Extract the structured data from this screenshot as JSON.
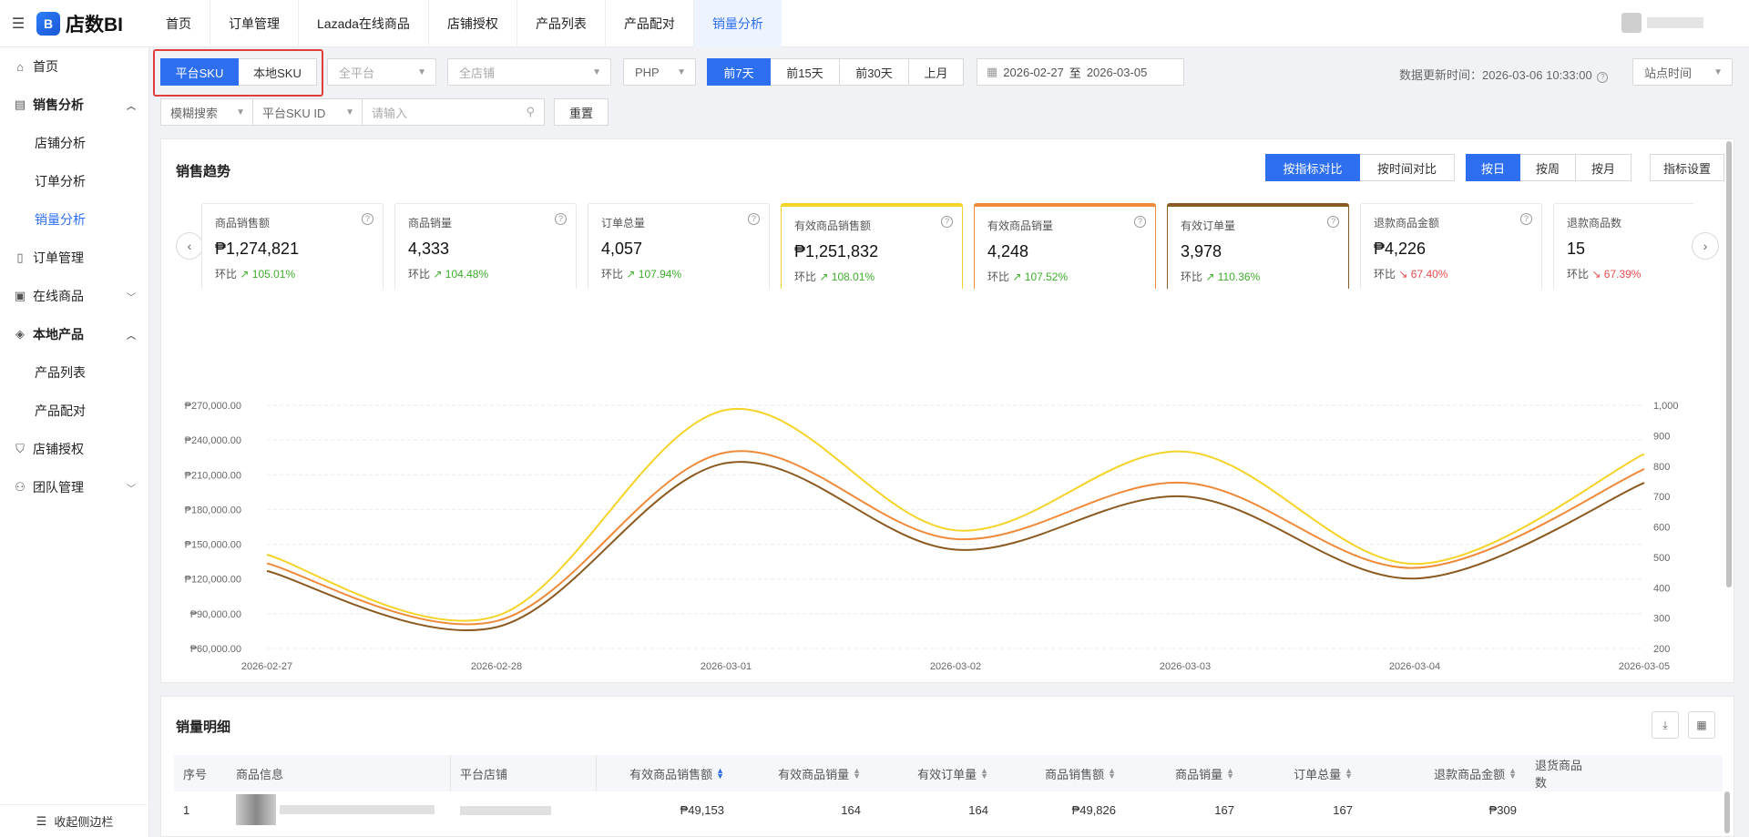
{
  "app": {
    "name": "店数BI",
    "logo_mark": "B"
  },
  "top_tabs": [
    {
      "label": "首页",
      "active": false
    },
    {
      "label": "订单管理",
      "active": false
    },
    {
      "label": "Lazada在线商品",
      "active": false
    },
    {
      "label": "店铺授权",
      "active": false
    },
    {
      "label": "产品列表",
      "active": false
    },
    {
      "label": "产品配对",
      "active": false
    },
    {
      "label": "销量分析",
      "active": true
    }
  ],
  "sidebar": {
    "items": [
      {
        "label": "首页",
        "icon": "home-icon",
        "type": "top"
      },
      {
        "label": "销售分析",
        "icon": "chart-icon",
        "type": "group-open"
      },
      {
        "label": "店铺分析",
        "type": "sub"
      },
      {
        "label": "订单分析",
        "type": "sub"
      },
      {
        "label": "销量分析",
        "type": "sub-active"
      },
      {
        "label": "订单管理",
        "icon": "document-icon",
        "type": "top"
      },
      {
        "label": "在线商品",
        "icon": "shop-icon",
        "type": "group-closed"
      },
      {
        "label": "本地产品",
        "icon": "box-icon",
        "type": "group-open"
      },
      {
        "label": "产品列表",
        "type": "sub"
      },
      {
        "label": "产品配对",
        "type": "sub"
      },
      {
        "label": "店铺授权",
        "icon": "shield-icon",
        "type": "top"
      },
      {
        "label": "团队管理",
        "icon": "team-icon",
        "type": "group-closed"
      }
    ],
    "collapse_label": "收起侧边栏"
  },
  "filters": {
    "sku_platform": "平台SKU",
    "sku_local": "本地SKU",
    "platform_placeholder": "全平台",
    "shop_placeholder": "全店铺",
    "currency": "PHP",
    "period_buttons": [
      "前7天",
      "前15天",
      "前30天",
      "上月"
    ],
    "date_start": "2026-02-27",
    "date_sep": "至",
    "date_end": "2026-03-05",
    "update_time_label": "数据更新时间：2026-03-06 10:33:00",
    "site_time": "站点时间",
    "fuzzy_search": "模糊搜索",
    "search_field": "平台SKU ID",
    "search_placeholder": "请输入",
    "reset": "重置"
  },
  "trend": {
    "title": "销售趋势",
    "compare_by_metric": "按指标对比",
    "compare_by_time": "按时间对比",
    "by_day": "按日",
    "by_week": "按周",
    "by_month": "按月",
    "metric_settings": "指标设置",
    "ratio_label": "环比",
    "metrics": [
      {
        "label": "商品销售额",
        "value": "₱1,274,821",
        "ratio": "105.01%",
        "dir": "up",
        "highlight": ""
      },
      {
        "label": "商品销量",
        "value": "4,333",
        "ratio": "104.48%",
        "dir": "up",
        "highlight": ""
      },
      {
        "label": "订单总量",
        "value": "4,057",
        "ratio": "107.94%",
        "dir": "up",
        "highlight": ""
      },
      {
        "label": "有效商品销售额",
        "value": "₱1,251,832",
        "ratio": "108.01%",
        "dir": "up",
        "highlight": "#f5d327"
      },
      {
        "label": "有效商品销量",
        "value": "4,248",
        "ratio": "107.52%",
        "dir": "up",
        "highlight": "#ee8a3a"
      },
      {
        "label": "有效订单量",
        "value": "3,978",
        "ratio": "110.36%",
        "dir": "up",
        "highlight": "#8b5a20"
      },
      {
        "label": "退款商品金额",
        "value": "₱4,226",
        "ratio": "67.40%",
        "dir": "down",
        "highlight": ""
      },
      {
        "label": "退款商品数",
        "value": "15",
        "ratio": "67.39%",
        "dir": "down",
        "highlight": ""
      }
    ]
  },
  "chart_data": {
    "type": "line",
    "x": [
      "2026-02-27",
      "2026-02-28",
      "2026-03-01",
      "2026-03-02",
      "2026-03-03",
      "2026-03-04",
      "2026-03-05"
    ],
    "y_left_ticks": [
      "₱270,000.00",
      "₱240,000.00",
      "₱210,000.00",
      "₱180,000.00",
      "₱150,000.00",
      "₱120,000.00",
      "₱90,000.00",
      "₱60,000.00"
    ],
    "y_right_ticks": [
      "1,000",
      "900",
      "800",
      "700",
      "600",
      "500",
      "400",
      "300",
      "200"
    ],
    "y_left_range": [
      60000,
      270000
    ],
    "y_right_range": [
      200,
      1000
    ],
    "grid": true,
    "legend_position": "bottom-center",
    "series": [
      {
        "name": "有效商品销售额",
        "axis": "left",
        "color": "#f5d327",
        "values": [
          141000,
          88000,
          266000,
          162000,
          230000,
          133000,
          228000
        ]
      },
      {
        "name": "有效商品销量",
        "axis": "right",
        "color": "#ee8a3a",
        "values": [
          480,
          290,
          845,
          560,
          745,
          465,
          790
        ]
      },
      {
        "name": "有效订单量",
        "axis": "right",
        "color": "#8b5a20",
        "values": [
          455,
          270,
          810,
          525,
          700,
          430,
          745
        ]
      }
    ]
  },
  "detail": {
    "title": "销量明细",
    "columns": [
      {
        "label": "序号",
        "sortable": false,
        "align": "left"
      },
      {
        "label": "商品信息",
        "sortable": false,
        "align": "left"
      },
      {
        "label": "平台店铺",
        "sortable": false,
        "align": "left"
      },
      {
        "label": "有效商品销售额",
        "sortable": true,
        "align": "right",
        "active": true
      },
      {
        "label": "有效商品销量",
        "sortable": true,
        "align": "right"
      },
      {
        "label": "有效订单量",
        "sortable": true,
        "align": "right"
      },
      {
        "label": "商品销售额",
        "sortable": true,
        "align": "right"
      },
      {
        "label": "商品销量",
        "sortable": true,
        "align": "right"
      },
      {
        "label": "订单总量",
        "sortable": true,
        "align": "right"
      },
      {
        "label": "退款商品金额",
        "sortable": true,
        "align": "right"
      },
      {
        "label": "退货商品数",
        "sortable": false,
        "align": "right"
      }
    ],
    "rows": [
      {
        "index": "1",
        "cells": [
          "₱49,153",
          "164",
          "164",
          "₱49,826",
          "167",
          "167",
          "₱309"
        ]
      }
    ]
  }
}
